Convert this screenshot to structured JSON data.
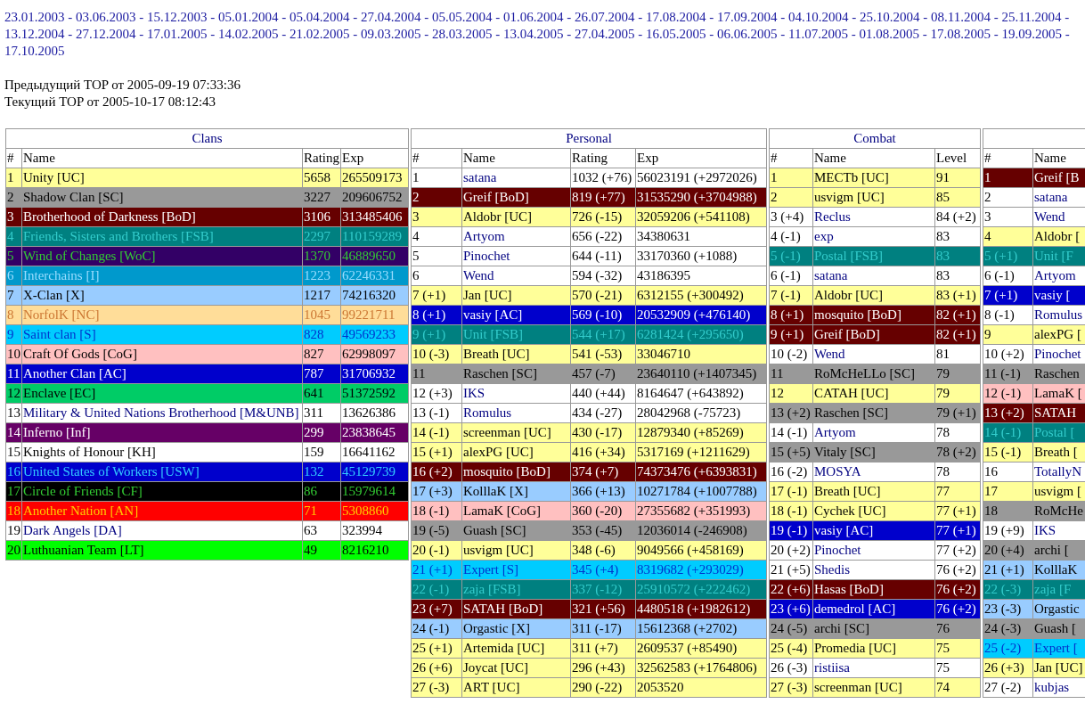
{
  "history": {
    "separator": "-",
    "dates": [
      "23.01.2003",
      "03.06.2003",
      "15.12.2003",
      "05.01.2004",
      "05.04.2004",
      "27.04.2004",
      "05.05.2004",
      "01.06.2004",
      "26.07.2004",
      "17.08.2004",
      "17.09.2004",
      "04.10.2004",
      "25.10.2004",
      "08.11.2004",
      "25.11.2004",
      "13.12.2004",
      "27.12.2004",
      "17.01.2005",
      "14.02.2005",
      "21.02.2005",
      "09.03.2005",
      "28.03.2005",
      "13.04.2005",
      "27.04.2005",
      "16.05.2005",
      "06.06.2005",
      "11.07.2005",
      "01.08.2005",
      "17.08.2005",
      "19.09.2005",
      "17.10.2005"
    ]
  },
  "previous_top": "Предыдущий TOP от 2005-09-19 07:33:36",
  "current_top": "Текущий TOP от 2005-10-17 08:12:43",
  "tables": [
    {
      "title": "Clans",
      "columns": [
        "#",
        "Name",
        "Rating",
        "Exp"
      ],
      "rows": [
        {
          "cells": [
            "1",
            "Unity [UC]",
            "5658",
            "265509173"
          ],
          "color": "#ffff99",
          "kind": "plain",
          "linked": false
        },
        {
          "cells": [
            "2",
            "Shadow Clan [SC]",
            "3227",
            "209606752"
          ],
          "color": "#999999",
          "kind": "plain",
          "linked": false
        },
        {
          "cells": [
            "3",
            "Brotherhood of Darkness [BoD]",
            "3106",
            "313485406"
          ],
          "color": "#660000",
          "kind": "light",
          "linked": false
        },
        {
          "cells": [
            "4",
            "Friends, Sisters and Brothers [FSB]",
            "2297",
            "110159289"
          ],
          "color": "#008080",
          "kind": "teal",
          "linked": false
        },
        {
          "cells": [
            "5",
            "Wind of Changes [WoC]",
            "1370",
            "46889650"
          ],
          "color": "#330066",
          "kind": "green",
          "linked": false
        },
        {
          "cells": [
            "6",
            "Interchains [I]",
            "1223",
            "62246331"
          ],
          "color": "#0099cc",
          "kind": "pale",
          "linked": false
        },
        {
          "cells": [
            "7",
            "X-Clan [X]",
            "1217",
            "74216320"
          ],
          "color": "#99ccff",
          "kind": "plain",
          "linked": false
        },
        {
          "cells": [
            "8",
            "NorfolK [NC]",
            "1045",
            "99221711"
          ],
          "color": "#ffdd99",
          "kind": "orange",
          "linked": false
        },
        {
          "cells": [
            "9",
            "Saint clan [S]",
            "828",
            "49569233"
          ],
          "color": "#00ccff",
          "kind": "blue",
          "linked": false
        },
        {
          "cells": [
            "10",
            "Craft Of Gods [CoG]",
            "827",
            "62998097"
          ],
          "color": "#ffc0c0",
          "kind": "plain",
          "linked": false
        },
        {
          "cells": [
            "11",
            "Another Clan [AC]",
            "787",
            "31706932"
          ],
          "color": "#0000cc",
          "kind": "light",
          "linked": false
        },
        {
          "cells": [
            "12",
            "Enclave [EC]",
            "641",
            "51372592"
          ],
          "color": "#00cc66",
          "kind": "plain",
          "linked": false
        },
        {
          "cells": [
            "13",
            "Military & United Nations Brotherhood [M&UNB]",
            "311",
            "13626386"
          ],
          "color": "#ffffff",
          "kind": "plain",
          "linked": true
        },
        {
          "cells": [
            "14",
            "Inferno [Inf]",
            "299",
            "23838645"
          ],
          "color": "#660066",
          "kind": "light",
          "linked": false
        },
        {
          "cells": [
            "15",
            "Knights of Honour [KH]",
            "159",
            "16641162"
          ],
          "color": "#ffffff",
          "kind": "plain",
          "linked": false
        },
        {
          "cells": [
            "16",
            "United States of Workers [USW]",
            "132",
            "45129739"
          ],
          "color": "#0000cc",
          "kind": "sky",
          "linked": false
        },
        {
          "cells": [
            "17",
            "Circle of Friends [CF]",
            "86",
            "15979614"
          ],
          "color": "#000000",
          "kind": "green",
          "linked": false
        },
        {
          "cells": [
            "18",
            "Another Nation [AN]",
            "71",
            "5308860"
          ],
          "color": "#ff0000",
          "kind": "gold",
          "linked": false
        },
        {
          "cells": [
            "19",
            "Dark Angels [DA]",
            "63",
            "323994"
          ],
          "color": "#ffffff",
          "kind": "plain",
          "linked": true
        },
        {
          "cells": [
            "20",
            "Luthuanian Team [LT]",
            "49",
            "8216210"
          ],
          "color": "#00ff00",
          "kind": "plain",
          "linked": false
        }
      ]
    },
    {
      "title": "Personal",
      "columns": [
        "#",
        "Name",
        "Rating",
        "Exp"
      ],
      "rows": [
        {
          "cells": [
            "1",
            "satana",
            "1032 (+76)",
            "56023191 (+2972026)"
          ],
          "color": "#ffffff",
          "kind": "plain",
          "linked": true
        },
        {
          "cells": [
            "2",
            "Greif [BoD]",
            "819 (+77)",
            "31535290 (+3704988)"
          ],
          "color": "#660000",
          "kind": "light",
          "linked": false
        },
        {
          "cells": [
            "3",
            "Aldobr [UC]",
            "726 (-15)",
            "32059206 (+541108)"
          ],
          "color": "#ffff99",
          "kind": "plain",
          "linked": false
        },
        {
          "cells": [
            "4",
            "Artyom",
            "656 (-22)",
            "34380631"
          ],
          "color": "#ffffff",
          "kind": "plain",
          "linked": true
        },
        {
          "cells": [
            "5",
            "Pinochet",
            "644 (-11)",
            "33170360 (+1088)"
          ],
          "color": "#ffffff",
          "kind": "plain",
          "linked": true
        },
        {
          "cells": [
            "6",
            "Wend",
            "594 (-32)",
            "43186395"
          ],
          "color": "#ffffff",
          "kind": "plain",
          "linked": true
        },
        {
          "cells": [
            "7 (+1)",
            "Jan [UC]",
            "570 (-21)",
            "6312155 (+300492)"
          ],
          "color": "#ffff99",
          "kind": "plain",
          "linked": false
        },
        {
          "cells": [
            "8 (+1)",
            "vasiy [AC]",
            "569 (-10)",
            "20532909 (+476140)"
          ],
          "color": "#0000cc",
          "kind": "light",
          "linked": false
        },
        {
          "cells": [
            "9 (+1)",
            "Unit [FSB]",
            "544 (+17)",
            "6281424 (+295650)"
          ],
          "color": "#008080",
          "kind": "teal",
          "linked": false
        },
        {
          "cells": [
            "10 (-3)",
            "Breath [UC]",
            "541 (-53)",
            "33046710"
          ],
          "color": "#ffff99",
          "kind": "plain",
          "linked": false
        },
        {
          "cells": [
            "11",
            "Raschen [SC]",
            "457 (-7)",
            "23640110 (+1407345)"
          ],
          "color": "#999999",
          "kind": "plain",
          "linked": false
        },
        {
          "cells": [
            "12 (+3)",
            "IKS",
            "440 (+44)",
            "8164647 (+643892)"
          ],
          "color": "#ffffff",
          "kind": "plain",
          "linked": true
        },
        {
          "cells": [
            "13 (-1)",
            "Romulus",
            "434 (-27)",
            "28042968 (-75723)"
          ],
          "color": "#ffffff",
          "kind": "plain",
          "linked": true
        },
        {
          "cells": [
            "14 (-1)",
            "screenman [UC]",
            "430 (-17)",
            "12879340 (+85269)"
          ],
          "color": "#ffff99",
          "kind": "plain",
          "linked": false
        },
        {
          "cells": [
            "15 (+1)",
            "alexPG [UC]",
            "416 (+34)",
            "5317169 (+1211629)"
          ],
          "color": "#ffff99",
          "kind": "plain",
          "linked": false
        },
        {
          "cells": [
            "16 (+2)",
            "mosquito [BoD]",
            "374 (+7)",
            "74373476 (+6393831)"
          ],
          "color": "#660000",
          "kind": "light",
          "linked": false
        },
        {
          "cells": [
            "17 (+3)",
            "KolllaK [X]",
            "366 (+13)",
            "10271784 (+1007788)"
          ],
          "color": "#99ccff",
          "kind": "plain",
          "linked": false
        },
        {
          "cells": [
            "18 (-1)",
            "LamaK [CoG]",
            "360 (-20)",
            "27355682 (+351993)"
          ],
          "color": "#ffc0c0",
          "kind": "plain",
          "linked": false
        },
        {
          "cells": [
            "19 (-5)",
            "Guash [SC]",
            "353 (-45)",
            "12036014 (-246908)"
          ],
          "color": "#999999",
          "kind": "plain",
          "linked": false
        },
        {
          "cells": [
            "20 (-1)",
            "usvigm [UC]",
            "348 (-6)",
            "9049566 (+458169)"
          ],
          "color": "#ffff99",
          "kind": "plain",
          "linked": false
        },
        {
          "cells": [
            "21 (+1)",
            "Expert [S]",
            "345 (+4)",
            "8319682 (+293029)"
          ],
          "color": "#00ccff",
          "kind": "blue",
          "linked": false
        },
        {
          "cells": [
            "22 (-1)",
            "zaja [FSB]",
            "337 (-12)",
            "25910572 (+222462)"
          ],
          "color": "#008080",
          "kind": "teal",
          "linked": false
        },
        {
          "cells": [
            "23 (+7)",
            "SATAH [BoD]",
            "321 (+56)",
            "4480518 (+1982612)"
          ],
          "color": "#660000",
          "kind": "light",
          "linked": false
        },
        {
          "cells": [
            "24 (-1)",
            "Orgastic [X]",
            "311 (-17)",
            "15612368 (+2702)"
          ],
          "color": "#99ccff",
          "kind": "plain",
          "linked": false
        },
        {
          "cells": [
            "25 (+1)",
            "Artemida [UC]",
            "311 (+7)",
            "2609537 (+85490)"
          ],
          "color": "#ffff99",
          "kind": "plain",
          "linked": false
        },
        {
          "cells": [
            "26 (+6)",
            "Joycat [UC]",
            "296 (+43)",
            "32562583 (+1764806)"
          ],
          "color": "#ffff99",
          "kind": "plain",
          "linked": false
        },
        {
          "cells": [
            "27 (-3)",
            "ART [UC]",
            "290 (-22)",
            "2053520"
          ],
          "color": "#ffff99",
          "kind": "plain",
          "linked": false
        }
      ]
    },
    {
      "title": "Combat",
      "columns": [
        "#",
        "Name",
        "Level"
      ],
      "rows": [
        {
          "cells": [
            "1",
            "MECTb [UC]",
            "91"
          ],
          "color": "#ffff99",
          "kind": "plain",
          "linked": false
        },
        {
          "cells": [
            "2",
            "usvigm [UC]",
            "85"
          ],
          "color": "#ffff99",
          "kind": "plain",
          "linked": false
        },
        {
          "cells": [
            "3 (+4)",
            "Reclus",
            "84 (+2)"
          ],
          "color": "#ffffff",
          "kind": "plain",
          "linked": true
        },
        {
          "cells": [
            "4 (-1)",
            "exp",
            "83"
          ],
          "color": "#ffffff",
          "kind": "plain",
          "linked": true
        },
        {
          "cells": [
            "5 (-1)",
            "Postal [FSB]",
            "83"
          ],
          "color": "#008080",
          "kind": "teal",
          "linked": false
        },
        {
          "cells": [
            "6 (-1)",
            "satana",
            "83"
          ],
          "color": "#ffffff",
          "kind": "plain",
          "linked": true
        },
        {
          "cells": [
            "7 (-1)",
            "Aldobr [UC]",
            "83 (+1)"
          ],
          "color": "#ffff99",
          "kind": "plain",
          "linked": false
        },
        {
          "cells": [
            "8 (+1)",
            "mosquito [BoD]",
            "82 (+1)"
          ],
          "color": "#660000",
          "kind": "light",
          "linked": false
        },
        {
          "cells": [
            "9 (+1)",
            "Greif [BoD]",
            "82 (+1)"
          ],
          "color": "#660000",
          "kind": "light",
          "linked": false
        },
        {
          "cells": [
            "10 (-2)",
            "Wend",
            "81"
          ],
          "color": "#ffffff",
          "kind": "plain",
          "linked": true
        },
        {
          "cells": [
            "11",
            "RoMcHeLLo [SC]",
            "79"
          ],
          "color": "#999999",
          "kind": "plain",
          "linked": false
        },
        {
          "cells": [
            "12",
            "CATAH [UC]",
            "79"
          ],
          "color": "#ffff99",
          "kind": "plain",
          "linked": false
        },
        {
          "cells": [
            "13 (+2)",
            "Raschen [SC]",
            "79 (+1)"
          ],
          "color": "#999999",
          "kind": "plain",
          "linked": false
        },
        {
          "cells": [
            "14 (-1)",
            "Artyom",
            "78"
          ],
          "color": "#ffffff",
          "kind": "plain",
          "linked": true
        },
        {
          "cells": [
            "15 (+5)",
            "Vitaly [SC]",
            "78 (+2)"
          ],
          "color": "#999999",
          "kind": "plain",
          "linked": false
        },
        {
          "cells": [
            "16 (-2)",
            "MOSYA",
            "78"
          ],
          "color": "#ffffff",
          "kind": "plain",
          "linked": true
        },
        {
          "cells": [
            "17 (-1)",
            "Breath [UC]",
            "77"
          ],
          "color": "#ffff99",
          "kind": "plain",
          "linked": false
        },
        {
          "cells": [
            "18 (-1)",
            "Cychek [UC]",
            "77 (+1)"
          ],
          "color": "#ffff99",
          "kind": "plain",
          "linked": false
        },
        {
          "cells": [
            "19 (-1)",
            "vasiy [AC]",
            "77 (+1)"
          ],
          "color": "#0000cc",
          "kind": "light",
          "linked": false
        },
        {
          "cells": [
            "20 (+2)",
            "Pinochet",
            "77 (+2)"
          ],
          "color": "#ffffff",
          "kind": "plain",
          "linked": true
        },
        {
          "cells": [
            "21 (+5)",
            "Shedis",
            "76 (+2)"
          ],
          "color": "#ffffff",
          "kind": "plain",
          "linked": true
        },
        {
          "cells": [
            "22 (+6)",
            "Hasas [BoD]",
            "76 (+2)"
          ],
          "color": "#660000",
          "kind": "light",
          "linked": false
        },
        {
          "cells": [
            "23 (+6)",
            "demedrol [AC]",
            "76 (+2)"
          ],
          "color": "#0000cc",
          "kind": "light",
          "linked": false
        },
        {
          "cells": [
            "24 (-5)",
            "archi [SC]",
            "76"
          ],
          "color": "#999999",
          "kind": "plain",
          "linked": false
        },
        {
          "cells": [
            "25 (-4)",
            "Promedia [UC]",
            "75"
          ],
          "color": "#ffff99",
          "kind": "plain",
          "linked": false
        },
        {
          "cells": [
            "26 (-3)",
            "ristiisa",
            "75"
          ],
          "color": "#ffffff",
          "kind": "plain",
          "linked": true
        },
        {
          "cells": [
            "27 (-3)",
            "screenman [UC]",
            "74"
          ],
          "color": "#ffff99",
          "kind": "plain",
          "linked": false
        }
      ]
    },
    {
      "columns": [
        "#",
        "Name"
      ],
      "rows": [
        {
          "cells": [
            "1",
            "Greif [B"
          ],
          "color": "#660000",
          "kind": "light",
          "linked": false
        },
        {
          "cells": [
            "2",
            "satana"
          ],
          "color": "#ffffff",
          "kind": "plain",
          "linked": true
        },
        {
          "cells": [
            "3",
            "Wend"
          ],
          "color": "#ffffff",
          "kind": "plain",
          "linked": true
        },
        {
          "cells": [
            "4",
            "Aldobr ["
          ],
          "color": "#ffff99",
          "kind": "plain",
          "linked": false
        },
        {
          "cells": [
            "5 (+1)",
            "Unit [F"
          ],
          "color": "#008080",
          "kind": "teal",
          "linked": false
        },
        {
          "cells": [
            "6 (-1)",
            "Artyom"
          ],
          "color": "#ffffff",
          "kind": "plain",
          "linked": true
        },
        {
          "cells": [
            "7 (+1)",
            "vasiy ["
          ],
          "color": "#0000cc",
          "kind": "light",
          "linked": false
        },
        {
          "cells": [
            "8 (-1)",
            "Romulus"
          ],
          "color": "#ffffff",
          "kind": "plain",
          "linked": true
        },
        {
          "cells": [
            "9",
            "alexPG ["
          ],
          "color": "#ffff99",
          "kind": "plain",
          "linked": false
        },
        {
          "cells": [
            "10 (+2)",
            "Pinochet"
          ],
          "color": "#ffffff",
          "kind": "plain",
          "linked": true
        },
        {
          "cells": [
            "11 (-1)",
            "Raschen"
          ],
          "color": "#999999",
          "kind": "plain",
          "linked": false
        },
        {
          "cells": [
            "12 (-1)",
            "LamaK ["
          ],
          "color": "#ffc0c0",
          "kind": "plain",
          "linked": false
        },
        {
          "cells": [
            "13 (+2)",
            "SATAH"
          ],
          "color": "#660000",
          "kind": "light",
          "linked": false
        },
        {
          "cells": [
            "14 (-1)",
            "Postal ["
          ],
          "color": "#008080",
          "kind": "teal",
          "linked": false
        },
        {
          "cells": [
            "15 (-1)",
            "Breath ["
          ],
          "color": "#ffff99",
          "kind": "plain",
          "linked": false
        },
        {
          "cells": [
            "16",
            "TotallyN"
          ],
          "color": "#ffffff",
          "kind": "plain",
          "linked": true
        },
        {
          "cells": [
            "17",
            "usvigm ["
          ],
          "color": "#ffff99",
          "kind": "plain",
          "linked": false
        },
        {
          "cells": [
            "18",
            "RoMcHe"
          ],
          "color": "#999999",
          "kind": "plain",
          "linked": false
        },
        {
          "cells": [
            "19 (+9)",
            "IKS"
          ],
          "color": "#ffffff",
          "kind": "plain",
          "linked": true
        },
        {
          "cells": [
            "20 (+4)",
            "archi ["
          ],
          "color": "#999999",
          "kind": "plain",
          "linked": false
        },
        {
          "cells": [
            "21 (+1)",
            "KolllaK"
          ],
          "color": "#99ccff",
          "kind": "plain",
          "linked": false
        },
        {
          "cells": [
            "22 (-3)",
            "zaja [F"
          ],
          "color": "#008080",
          "kind": "teal",
          "linked": false
        },
        {
          "cells": [
            "23 (-3)",
            "Orgastic"
          ],
          "color": "#99ccff",
          "kind": "plain",
          "linked": false
        },
        {
          "cells": [
            "24 (-3)",
            "Guash ["
          ],
          "color": "#999999",
          "kind": "plain",
          "linked": false
        },
        {
          "cells": [
            "25 (-2)",
            "Expert ["
          ],
          "color": "#00ccff",
          "kind": "blue",
          "linked": false
        },
        {
          "cells": [
            "26 (+3)",
            "Jan [UC]"
          ],
          "color": "#ffff99",
          "kind": "plain",
          "linked": false
        },
        {
          "cells": [
            "27 (-2)",
            "kubjas"
          ],
          "color": "#ffffff",
          "kind": "plain",
          "linked": true
        }
      ]
    }
  ]
}
